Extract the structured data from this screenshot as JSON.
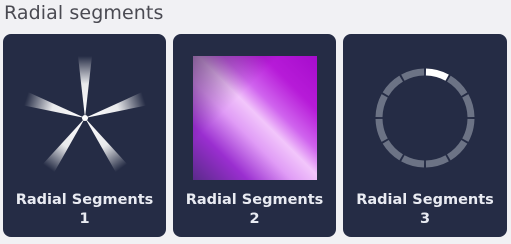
{
  "section": {
    "title": "Radial segments"
  },
  "cards": [
    {
      "label_line1": "Radial Segments",
      "label_line2": "1",
      "icon": "radial-spokes"
    },
    {
      "label_line1": "Radial Segments",
      "label_line2": "2",
      "icon": "purple-gradient-square"
    },
    {
      "label_line1": "Radial Segments",
      "label_line2": "3",
      "icon": "segmented-ring"
    }
  ],
  "colors": {
    "page_bg": "#f1f1f4",
    "card_bg": "#252c45",
    "label_text": "#e9ebf2",
    "purple_dark": "#7a10a8",
    "purple_mid": "#b21ad6",
    "purple_light": "#e8a4f8",
    "ring_segment": "#6c7385",
    "ring_highlight": "#ffffff"
  }
}
